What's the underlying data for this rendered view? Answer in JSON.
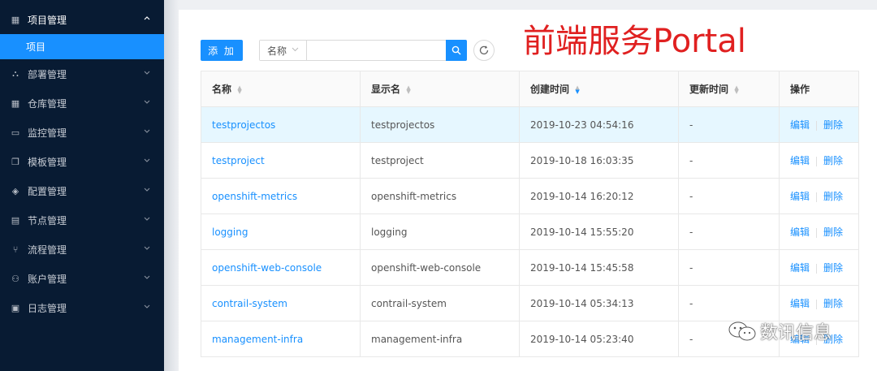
{
  "sidebar": {
    "items": [
      {
        "icon": "grid-icon",
        "label": "项目管理",
        "open": true,
        "chevron": "up"
      },
      {
        "icon": "deploy-icon",
        "label": "部署管理",
        "chevron": "down"
      },
      {
        "icon": "table-icon",
        "label": "仓库管理",
        "chevron": "down"
      },
      {
        "icon": "monitor-icon",
        "label": "监控管理",
        "chevron": "down"
      },
      {
        "icon": "template-icon",
        "label": "模板管理",
        "chevron": "down"
      },
      {
        "icon": "tag-icon",
        "label": "配置管理",
        "chevron": "down"
      },
      {
        "icon": "node-icon",
        "label": "节点管理",
        "chevron": "down"
      },
      {
        "icon": "flow-icon",
        "label": "流程管理",
        "chevron": "down"
      },
      {
        "icon": "user-icon",
        "label": "账户管理",
        "chevron": "down"
      },
      {
        "icon": "log-icon",
        "label": "日志管理",
        "chevron": "down"
      }
    ],
    "sub_item": "项目"
  },
  "toolbar": {
    "add_label": "添 加",
    "search_field": "名称",
    "search_value": "",
    "search_placeholder": ""
  },
  "overlay_title": "前端服务Portal",
  "table": {
    "headers": [
      "名称",
      "显示名",
      "创建时间",
      "更新时间",
      "操作"
    ],
    "rows": [
      {
        "name": "testprojectos",
        "display": "testprojectos",
        "created": "2019-10-23 04:54:16",
        "updated": "-"
      },
      {
        "name": "testproject",
        "display": "testproject",
        "created": "2019-10-18 16:03:35",
        "updated": "-"
      },
      {
        "name": "openshift-metrics",
        "display": "openshift-metrics",
        "created": "2019-10-14 16:20:12",
        "updated": "-"
      },
      {
        "name": "logging",
        "display": "logging",
        "created": "2019-10-14 15:55:20",
        "updated": "-"
      },
      {
        "name": "openshift-web-console",
        "display": "openshift-web-console",
        "created": "2019-10-14 15:45:58",
        "updated": "-"
      },
      {
        "name": "contrail-system",
        "display": "contrail-system",
        "created": "2019-10-14 05:34:13",
        "updated": "-"
      },
      {
        "name": "management-infra",
        "display": "management-infra",
        "created": "2019-10-14 05:23:40",
        "updated": "-"
      }
    ],
    "edit_label": "编辑",
    "delete_label": "删除"
  },
  "watermark": "数讯信息",
  "colors": {
    "sidebar_bg": "#081b33",
    "accent": "#1890ff",
    "title_red": "#e02020",
    "row_highlight": "#e6f7ff"
  }
}
